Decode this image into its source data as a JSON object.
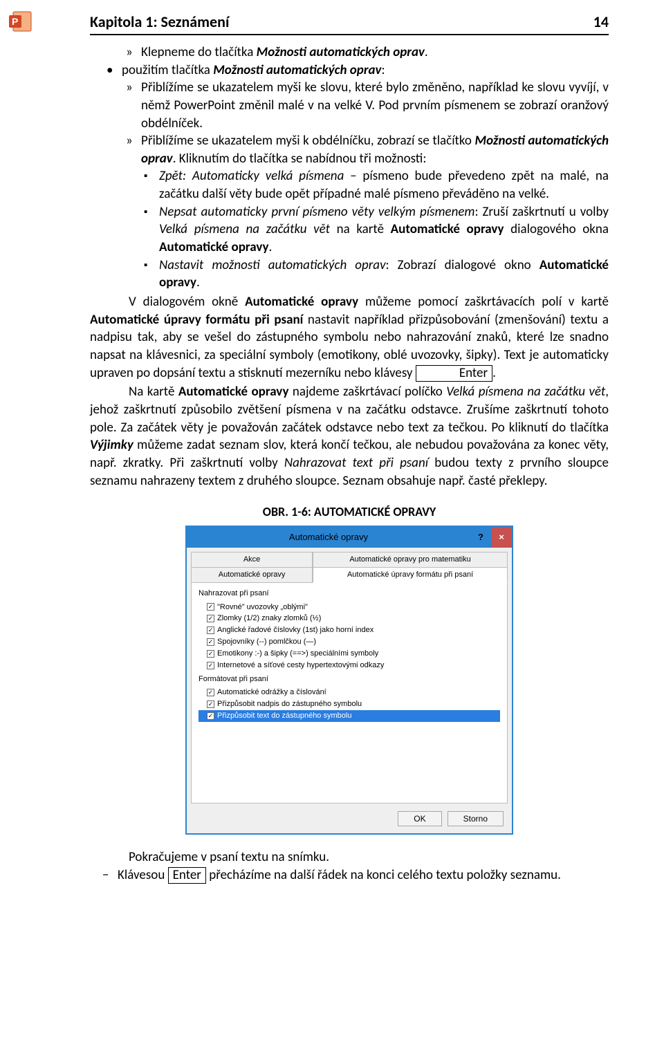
{
  "icon": {
    "name": "powerpoint-icon"
  },
  "header": {
    "chapter_title": "Kapitola 1: Seznámení",
    "page_number": "14"
  },
  "body": {
    "l1": "Klepneme do tlačítka ",
    "l1b": "Možnosti automatických oprav",
    "l1c": ".",
    "l2a": "použitím tlačítka ",
    "l2b": "Možnosti automatických oprav",
    "l2c": ":",
    "l3": "Přiblížíme se ukazatelem myši ke slovu, které bylo změněno, například ke slovu vyvíjí, v němž PowerPoint změnil malé v na velké V. Pod prvním písmenem se zobrazí oranžový obdélníček.",
    "l4a": "Přiblížíme se ukazatelem myši k obdélníčku, zobrazí se tlačítko ",
    "l4b": "Možnosti automatických oprav",
    "l4c": ". Kliknutím do tlačítka se nabídnou tři možnosti:",
    "sq1a": "Zpět: Automaticky velká písmena",
    "sq1b": " – písmeno bude převedeno zpět na malé, na začátku další věty bude opět případné malé písmeno převáděno na velké.",
    "sq2a": "Nepsat automaticky první písmeno věty velkým písmenem",
    "sq2b": ": Zruší zaškrtnutí u volby ",
    "sq2c": "Velká písmena na začátku vět",
    "sq2d": " na kartě ",
    "sq2e": "Automatické opravy",
    "sq2f": " dialogového okna ",
    "sq2g": "Automatické opravy",
    "sq2h": ".",
    "sq3a": "Nastavit možnosti automatických oprav",
    "sq3b": ": Zobrazí dialogové okno ",
    "sq3c": "Automatické opravy",
    "sq3d": ".",
    "para1a": "V dialogovém okně ",
    "para1b": "Automatické opravy",
    "para1c": " můžeme pomocí zaškrtávacích polí v kartě ",
    "para1d": "Automatické úpravy formátu při psaní",
    "para1e": " nastavit například přizpůsobování (zmenšování) textu a nadpisu tak, aby se vešel do zástupného symbolu nebo nahrazování znaků, které lze snadno napsat na klávesnici, za speciální symboly (emotikony, oblé uvozovky, šipky). Text je automaticky upraven po dopsání textu a stisknutí mezerníku nebo klávesy ",
    "para1f": "Enter",
    "para1g": ".",
    "para2a": "Na kartě ",
    "para2b": "Automatické opravy",
    "para2c": " najdeme zaškrtávací políčko ",
    "para2d": "Velká písmena na začátku vět",
    "para2e": ", jehož zaškrtnutí způsobilo zvětšení písmena v na začátku odstavce. Zrušíme zaškrtnutí tohoto pole. Za začátek věty je považován začátek odstavce nebo text za tečkou. Po kliknutí do tlačítka ",
    "para2f": "Výjimky",
    "para2g": " můžeme zadat seznam slov, která končí tečkou, ale nebudou považována za konec věty, např. zkratky. Při zaškrtnutí volby ",
    "para2h": "Nahrazovat text při psaní",
    "para2i": " budou texty z prvního sloupce seznamu nahrazeny textem z druhého sloupce. Seznam obsahuje např. časté překlepy.",
    "fig_caption_prefix": "OBR. 1-6: A",
    "fig_caption_sc": "UTOMATICKÉ OPRAVY",
    "closing1": "Pokračujeme v psaní textu na snímku.",
    "closing2a": "Klávesou ",
    "closing2b": "Enter",
    "closing2c": " přecházíme na další řádek na konci celého textu položky seznamu."
  },
  "dialog": {
    "title": "Automatické opravy",
    "help_symbol": "?",
    "close_symbol": "×",
    "tabs": {
      "t1": "Akce",
      "t2": "Automatické opravy pro matematiku",
      "t3": "Automatické opravy",
      "t4": "Automatické úpravy formátu při psaní"
    },
    "section1": "Nahrazovat při psaní",
    "opts1": [
      "\"Rovné\" uvozovky „oblými\"",
      "Zlomky (1/2) znaky zlomků (½)",
      "Anglické řadové číslovky (1st) jako horní index",
      "Spojovníky (--) pomlčkou (—)",
      "Emotikony :-) a šipky (==>) speciálními symboly",
      "Internetové a síťové cesty hypertextovými odkazy"
    ],
    "section2": "Formátovat při psaní",
    "opts2": [
      "Automatické odrážky a číslování",
      "Přizpůsobit nadpis do zástupného symbolu",
      "Přizpůsobit text do zástupného symbolu"
    ],
    "btn_ok": "OK",
    "btn_cancel": "Storno"
  }
}
